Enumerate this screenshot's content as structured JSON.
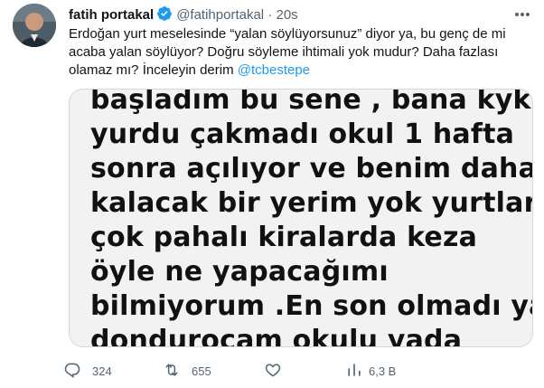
{
  "tweet": {
    "display_name": "fatih portakal",
    "handle": "@fatihportakal",
    "separator": "·",
    "time": "20s",
    "text_before": "Erdoğan yurt meselesinde “yalan söylüyorsunuz” diyor ya, bu genç de mi acaba yalan söylüyor? Doğru söyleme ihtimali yok mudur? Daha fazlası olamaz mı? İnceleyin derim ",
    "mention": "@tcbestepe"
  },
  "media": {
    "lines": [
      "başladım bu sene , bana kyk",
      "yurdu çakmadı okul 1 hafta",
      "sonra açılıyor ve benim daha",
      "kalacak bir yerim yok yurtlar",
      "çok pahalı kiralarda keza",
      "öyle ne yapacağımı",
      "bilmiyorum .En son olmadı ya",
      "dondurocam okulu yada"
    ]
  },
  "actions": {
    "replies": "324",
    "retweets": "655",
    "likes": "",
    "views": "6,3 B"
  },
  "colors": {
    "accent": "#1d9bf0",
    "muted": "#536471",
    "verified": "#1d9bf0"
  },
  "icons": [
    "verified-badge-icon",
    "more-icon",
    "reply-icon",
    "retweet-icon",
    "like-icon",
    "views-icon"
  ]
}
